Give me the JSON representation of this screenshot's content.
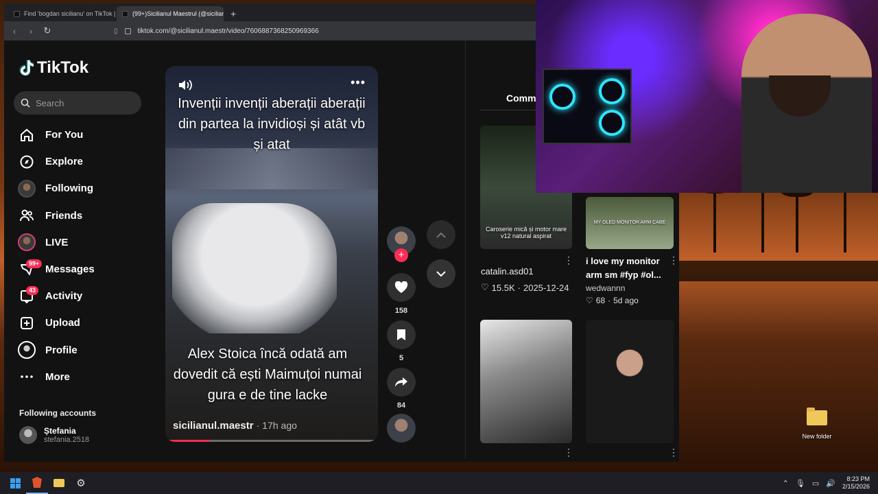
{
  "browser": {
    "tabs": [
      {
        "title": "Find 'bogdan sicilianu' on TikTok | Tik",
        "active": false
      },
      {
        "title": "(99+)Sicilianul Maestrul (@siciliar",
        "active": true
      }
    ],
    "url": "tiktok.com/@sicilianul.maestr/video/7606887368250969366"
  },
  "sidebar": {
    "logo": "TikTok",
    "search_placeholder": "Search",
    "nav": [
      {
        "label": "For You",
        "icon": "home-icon"
      },
      {
        "label": "Explore",
        "icon": "compass-icon"
      },
      {
        "label": "Following",
        "icon": "following-avatar-icon"
      },
      {
        "label": "Friends",
        "icon": "friends-icon"
      },
      {
        "label": "LIVE",
        "icon": "live-avatar-icon"
      },
      {
        "label": "Messages",
        "icon": "messages-icon",
        "badge": "99+"
      },
      {
        "label": "Activity",
        "icon": "activity-icon",
        "badge": "43"
      },
      {
        "label": "Upload",
        "icon": "upload-icon"
      },
      {
        "label": "Profile",
        "icon": "profile-icon"
      },
      {
        "label": "More",
        "icon": "more-icon"
      }
    ],
    "following_header": "Following accounts",
    "following_accounts": [
      {
        "name": "Ștefania",
        "handle": "stefania.2518"
      }
    ]
  },
  "video": {
    "title_overlay": "Invenții invenții aberații aberații din partea la invidioși și atât vb și atat",
    "caption_overlay": "Alex Stoica încă odată am dovedit că ești Maimuțoi numai gura e de tine lacke",
    "author": "sicilianul.maestr",
    "posted": "· 17h ago",
    "progress": 0.21
  },
  "actions": {
    "likes": "158",
    "saves": "5",
    "shares": "84"
  },
  "right_panel": {
    "comments_tab": "Comme",
    "cards": [
      {
        "thumb_text": "Caroserie mică și motor mare v12 natural aspirat",
        "author": "catalin.asd01",
        "likes": "15.5K",
        "date": "2025-12-24"
      },
      {
        "thumb_text": "MY OLED MONITOR ARM CABE",
        "title": "i love my monitor arm sm #fyp #ol...",
        "author": "wedwannn",
        "likes": "68",
        "date": "5d ago"
      }
    ]
  },
  "desktop": {
    "icon_label": "New folder"
  },
  "taskbar": {
    "time": "8:23 PM",
    "date": "2/15/2026"
  },
  "colors": {
    "accent": "#fe2c55",
    "background": "#121212"
  }
}
